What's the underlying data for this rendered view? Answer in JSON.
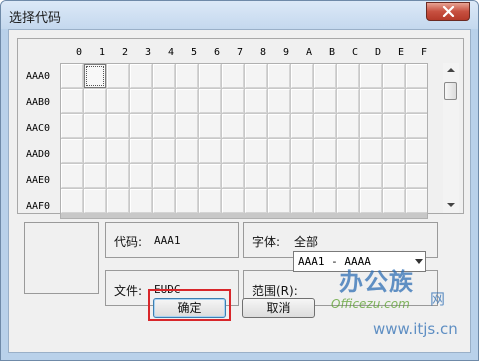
{
  "window": {
    "title": "选择代码",
    "close_icon": "close-icon"
  },
  "grid": {
    "columns": [
      "0",
      "1",
      "2",
      "3",
      "4",
      "5",
      "6",
      "7",
      "8",
      "9",
      "A",
      "B",
      "C",
      "D",
      "E",
      "F"
    ],
    "rows": [
      "AAA0",
      "AAB0",
      "AAC0",
      "AAD0",
      "AAE0",
      "AAF0"
    ],
    "selected_cell": {
      "row": "AAA0",
      "column": "1"
    }
  },
  "info": {
    "code_label": "代码:",
    "code_value": "AAA1",
    "font_label": "字体:",
    "font_value": "全部",
    "file_label": "文件:",
    "file_value": "EUDC",
    "range_label": "范围(R):",
    "range_value": "AAA1 - AAAA"
  },
  "buttons": {
    "ok": "确定",
    "cancel": "取消"
  },
  "watermark": {
    "line1": "办公族",
    "line2": "网",
    "line3": "Officezu.com",
    "line4": "www.itjs.cn"
  },
  "colors": {
    "highlight": "#d8262a",
    "titlebar": "#c4d8ee",
    "close_button": "#c75040"
  }
}
